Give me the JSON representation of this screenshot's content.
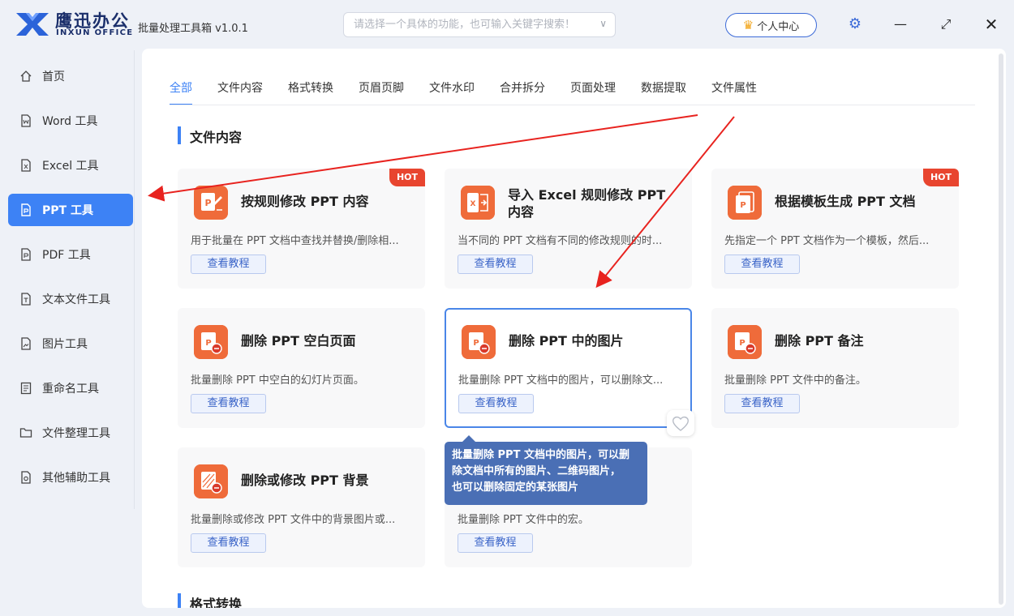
{
  "app": {
    "brand_cn": "鹰迅办公",
    "brand_en": "INXUN OFFICE",
    "title": "批量处理工具箱 v1.0.1"
  },
  "search": {
    "placeholder": "请选择一个具体的功能，也可输入关键字搜索！"
  },
  "header": {
    "user_center": "个人中心"
  },
  "sidebar": {
    "items": [
      {
        "label": "首页",
        "icon": "home-icon"
      },
      {
        "label": "Word 工具",
        "icon": "word-file-icon"
      },
      {
        "label": "Excel 工具",
        "icon": "excel-file-icon"
      },
      {
        "label": "PPT 工具",
        "icon": "ppt-file-icon",
        "active": true
      },
      {
        "label": "PDF 工具",
        "icon": "pdf-file-icon"
      },
      {
        "label": "文本文件工具",
        "icon": "text-file-icon"
      },
      {
        "label": "图片工具",
        "icon": "image-file-icon"
      },
      {
        "label": "重命名工具",
        "icon": "rename-icon"
      },
      {
        "label": "文件整理工具",
        "icon": "folder-icon"
      },
      {
        "label": "其他辅助工具",
        "icon": "tools-icon"
      }
    ]
  },
  "tabs": [
    "全部",
    "文件内容",
    "格式转换",
    "页眉页脚",
    "文件水印",
    "合并拆分",
    "页面处理",
    "数据提取",
    "文件属性"
  ],
  "sections": {
    "content_title": "文件内容",
    "format_title": "格式转换"
  },
  "cards": [
    {
      "title": "按规则修改 PPT 内容",
      "desc": "用于批量在 PPT 文档中查找并替换/删除相...",
      "hot": "HOT"
    },
    {
      "title": "导入 Excel 规则修改 PPT 内容",
      "desc": "当不同的 PPT 文档有不同的修改规则的时..."
    },
    {
      "title": "根据模板生成 PPT 文档",
      "desc": "先指定一个 PPT 文档作为一个模板，然后...",
      "hot": "HOT"
    },
    {
      "title": "删除 PPT 空白页面",
      "desc": "批量删除 PPT 中空白的幻灯片页面。"
    },
    {
      "title": "删除 PPT 中的图片",
      "desc": "批量删除 PPT 文档中的图片，可以删除文..."
    },
    {
      "title": "删除 PPT 备注",
      "desc": "批量删除 PPT 文件中的备注。"
    },
    {
      "title": "删除或修改 PPT 背景",
      "desc": "批量删除或修改 PPT 文件中的背景图片或..."
    },
    {
      "title": "",
      "desc": "批量删除 PPT 文件中的宏。"
    }
  ],
  "card_button": "查看教程",
  "tooltip": {
    "line1": "批量删除 PPT 文档中的图片，可以删",
    "line2": "除文档中所有的图片、二维码图片，",
    "line3": "也可以删除固定的某张图片"
  },
  "colors": {
    "accent": "#3d82f5",
    "hot": "#e8452f",
    "ppt_orange": "#ef6b3a",
    "arrow": "#e8231f"
  }
}
